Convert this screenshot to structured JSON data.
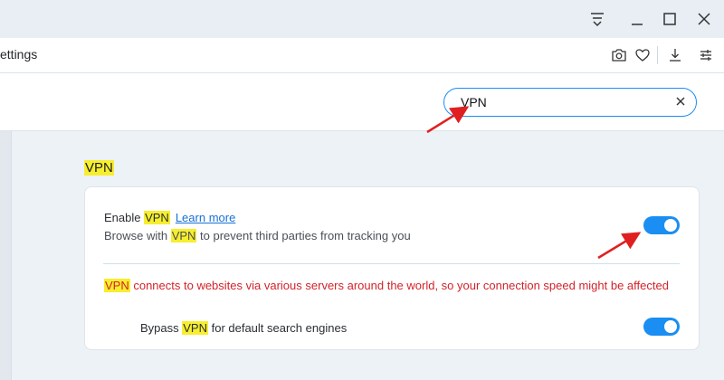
{
  "header": {
    "tab_title": "ettings",
    "icons": [
      "menu-icon",
      "minimize-icon",
      "maximize-icon",
      "close-icon",
      "camera-icon",
      "heart-icon",
      "download-icon",
      "sliders-icon"
    ]
  },
  "search": {
    "value": "VPN",
    "clear_icon": "clear-icon"
  },
  "section": {
    "title": "VPN"
  },
  "vpn": {
    "enable_prefix": "Enable ",
    "enable_highlight": "VPN",
    "learn_more": "Learn more",
    "desc_prefix": "Browse with ",
    "desc_highlight": "VPN",
    "desc_suffix": " to prevent third parties from tracking you",
    "enabled": true,
    "warning_highlight": "VPN",
    "warning_text": " connects to websites via various servers around the world, so your connection speed might be affected",
    "bypass_prefix": "Bypass ",
    "bypass_highlight": "VPN",
    "bypass_suffix": " for default search engines",
    "bypass_enabled": true
  },
  "colors": {
    "accent": "#1a8ef2",
    "highlight": "#f7ee2f",
    "warning": "#d3232a",
    "annotation_arrow": "#e02020"
  }
}
